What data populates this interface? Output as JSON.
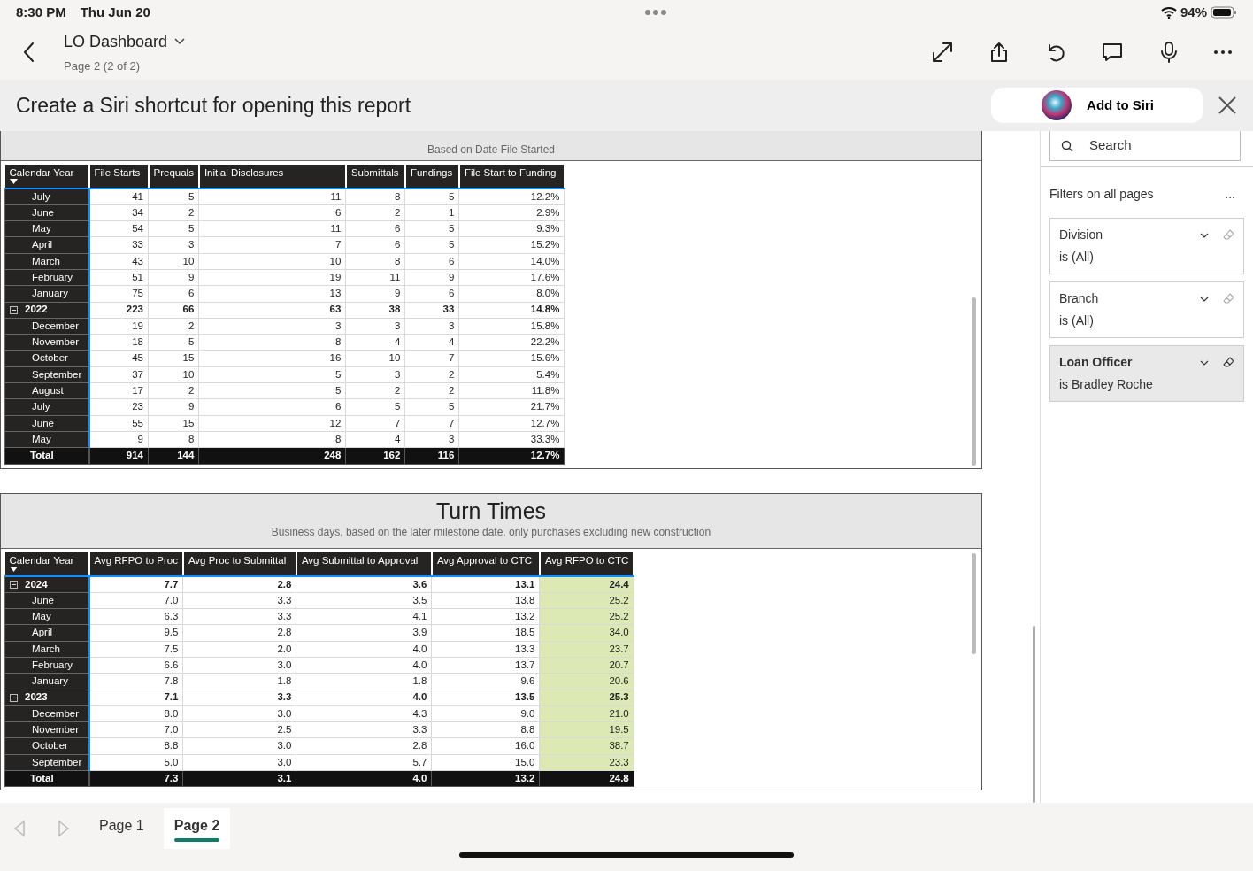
{
  "status_bar": {
    "time": "8:30 PM",
    "date": "Thu Jun 20",
    "battery": "94%"
  },
  "header": {
    "title": "LO Dashboard",
    "subtitle": "Page 2 (2 of 2)"
  },
  "siri_banner": {
    "text": "Create a Siri shortcut for opening this report",
    "button": "Add to Siri"
  },
  "visuals": [
    {
      "subtitle": "Based on Date File Started",
      "columns": [
        {
          "label": "Calendar Year",
          "highlight": false
        },
        {
          "label": "File Starts",
          "highlight": false
        },
        {
          "label": "Prequals",
          "highlight": false
        },
        {
          "label": "Initial Disclosures",
          "highlight": false
        },
        {
          "label": "Submittals",
          "highlight": false
        },
        {
          "label": "Fundings",
          "highlight": false
        },
        {
          "label": "File Start to Funding",
          "highlight": false
        }
      ],
      "rows": [
        {
          "kind": "month",
          "cells": [
            "July",
            "41",
            "5",
            "11",
            "8",
            "5",
            "12.2%"
          ]
        },
        {
          "kind": "month",
          "cells": [
            "June",
            "34",
            "2",
            "6",
            "2",
            "1",
            "2.9%"
          ]
        },
        {
          "kind": "month",
          "cells": [
            "May",
            "54",
            "5",
            "11",
            "6",
            "5",
            "9.3%"
          ]
        },
        {
          "kind": "month",
          "cells": [
            "April",
            "33",
            "3",
            "7",
            "6",
            "5",
            "15.2%"
          ]
        },
        {
          "kind": "month",
          "cells": [
            "March",
            "43",
            "10",
            "10",
            "8",
            "6",
            "14.0%"
          ]
        },
        {
          "kind": "month",
          "cells": [
            "February",
            "51",
            "9",
            "19",
            "11",
            "9",
            "17.6%"
          ]
        },
        {
          "kind": "month",
          "cells": [
            "January",
            "75",
            "6",
            "13",
            "9",
            "6",
            "8.0%"
          ]
        },
        {
          "kind": "year",
          "expanded": true,
          "cells": [
            "2022",
            "223",
            "66",
            "63",
            "38",
            "33",
            "14.8%"
          ]
        },
        {
          "kind": "month",
          "cells": [
            "December",
            "19",
            "2",
            "3",
            "3",
            "3",
            "15.8%"
          ]
        },
        {
          "kind": "month",
          "cells": [
            "November",
            "18",
            "5",
            "8",
            "4",
            "4",
            "22.2%"
          ]
        },
        {
          "kind": "month",
          "cells": [
            "October",
            "45",
            "15",
            "16",
            "10",
            "7",
            "15.6%"
          ]
        },
        {
          "kind": "month",
          "cells": [
            "September",
            "37",
            "10",
            "5",
            "3",
            "2",
            "5.4%"
          ]
        },
        {
          "kind": "month",
          "cells": [
            "August",
            "17",
            "2",
            "5",
            "2",
            "2",
            "11.8%"
          ]
        },
        {
          "kind": "month",
          "cells": [
            "July",
            "23",
            "9",
            "6",
            "5",
            "5",
            "21.7%"
          ]
        },
        {
          "kind": "month",
          "cells": [
            "June",
            "55",
            "15",
            "12",
            "7",
            "7",
            "12.7%"
          ]
        },
        {
          "kind": "month",
          "cells": [
            "May",
            "9",
            "8",
            "8",
            "4",
            "3",
            "33.3%"
          ]
        },
        {
          "kind": "total",
          "cells": [
            "Total",
            "914",
            "144",
            "248",
            "162",
            "116",
            "12.7%"
          ]
        }
      ]
    },
    {
      "title": "Turn Times",
      "subtitle": "Business days, based on the later milestone date, only purchases excluding new construction",
      "columns": [
        {
          "label": "Calendar Year",
          "highlight": false
        },
        {
          "label": "Avg RFPO to Proc",
          "highlight": false
        },
        {
          "label": "Avg Proc to Submittal",
          "highlight": false
        },
        {
          "label": "Avg Submittal to Approval",
          "highlight": false
        },
        {
          "label": "Avg Approval to CTC",
          "highlight": false
        },
        {
          "label": "Avg RFPO to CTC",
          "highlight": true
        }
      ],
      "rows": [
        {
          "kind": "year",
          "expanded": true,
          "cells": [
            "2024",
            "7.7",
            "2.8",
            "3.6",
            "13.1",
            "24.4"
          ]
        },
        {
          "kind": "month",
          "cells": [
            "June",
            "7.0",
            "3.3",
            "3.5",
            "13.8",
            "25.2"
          ]
        },
        {
          "kind": "month",
          "cells": [
            "May",
            "6.3",
            "3.3",
            "4.1",
            "13.2",
            "25.2"
          ]
        },
        {
          "kind": "month",
          "cells": [
            "April",
            "9.5",
            "2.8",
            "3.9",
            "18.5",
            "34.0"
          ]
        },
        {
          "kind": "month",
          "cells": [
            "March",
            "7.5",
            "2.0",
            "4.0",
            "13.3",
            "23.7"
          ]
        },
        {
          "kind": "month",
          "cells": [
            "February",
            "6.6",
            "3.0",
            "4.0",
            "13.7",
            "20.7"
          ]
        },
        {
          "kind": "month",
          "cells": [
            "January",
            "7.8",
            "1.8",
            "1.8",
            "9.6",
            "20.6"
          ]
        },
        {
          "kind": "year",
          "expanded": true,
          "cells": [
            "2023",
            "7.1",
            "3.3",
            "4.0",
            "13.5",
            "25.3"
          ]
        },
        {
          "kind": "month",
          "cells": [
            "December",
            "8.0",
            "3.0",
            "4.3",
            "9.0",
            "21.0"
          ]
        },
        {
          "kind": "month",
          "cells": [
            "November",
            "7.0",
            "2.5",
            "3.3",
            "8.8",
            "19.5"
          ]
        },
        {
          "kind": "month",
          "cells": [
            "October",
            "8.8",
            "3.0",
            "2.8",
            "16.0",
            "38.7"
          ]
        },
        {
          "kind": "month",
          "cells": [
            "September",
            "5.0",
            "3.0",
            "5.7",
            "15.0",
            "23.3"
          ]
        },
        {
          "kind": "total",
          "cells": [
            "Total",
            "7.3",
            "3.1",
            "4.0",
            "13.2",
            "24.8"
          ]
        }
      ]
    }
  ],
  "filter_pane": {
    "search": {
      "placeholder": "Search"
    },
    "section": "Filters on all pages",
    "more": "...",
    "filters": [
      {
        "name": "Division",
        "value": "is (All)",
        "applied": false
      },
      {
        "name": "Branch",
        "value": "is (All)",
        "applied": false
      },
      {
        "name": "Loan Officer",
        "value": "is Bradley Roche",
        "applied": true
      }
    ]
  },
  "pages": [
    {
      "label": "Page 1",
      "selected": false
    },
    {
      "label": "Page 2",
      "selected": true
    }
  ]
}
